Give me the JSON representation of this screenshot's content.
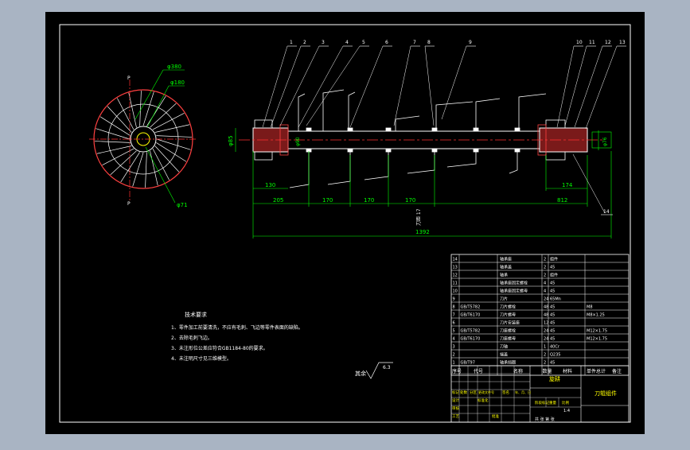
{
  "colors": {
    "background": "#a9b4c3",
    "sheet": "#000000",
    "border": "#ffffff",
    "dimension": "#00ff00",
    "centerline": "#ff3030",
    "outline": "#ff4040",
    "hatch": "#ffffff",
    "text": "#ffffff",
    "callout": "#ffffff"
  },
  "views": {
    "left_view": {
      "dia_outer": "φ380",
      "dia_mid": "φ180",
      "dia_inner": "φ71",
      "section_mark": "P"
    },
    "main_view": {
      "shaft_dia_left": "φ85",
      "shaft_dia_body": "φ90",
      "shaft_dia_right": "φ76",
      "dims": {
        "d130": "130",
        "d205": "205",
        "d170a": "170",
        "d170b": "170",
        "d170c": "170",
        "d174": "174",
        "d812": "812",
        "total": "1392"
      },
      "part_callouts": [
        "1",
        "2",
        "3",
        "4",
        "5",
        "6",
        "7",
        "8",
        "9",
        "10",
        "11",
        "12",
        "13",
        "14"
      ],
      "pitch_note": "刀距 17"
    }
  },
  "tech_requirements": {
    "title": "技术要求",
    "items": [
      "1、零件加工前要清洗，不应有毛刺、飞边等零件表面的缺陷。",
      "2、去除毛刺飞边。",
      "3、未注形位公差应符合GB1184-80的要求。",
      "4、未注明尺寸见三维模型。"
    ]
  },
  "roughness": {
    "label": "其余",
    "value": "6.3"
  },
  "bom": {
    "rows": [
      {
        "no": "14",
        "code": "",
        "name": "轴承座",
        "qty": "2",
        "material": "组件",
        "note": ""
      },
      {
        "no": "13",
        "code": "",
        "name": "轴承盖",
        "qty": "2",
        "material": "45",
        "note": ""
      },
      {
        "no": "12",
        "code": "",
        "name": "轴承",
        "qty": "2",
        "material": "组件",
        "note": ""
      },
      {
        "no": "11",
        "code": "",
        "name": "轴承座固定螺栓",
        "qty": "4",
        "material": "45",
        "note": ""
      },
      {
        "no": "10",
        "code": "",
        "name": "轴承座固定螺母",
        "qty": "4",
        "material": "45",
        "note": ""
      },
      {
        "no": "9",
        "code": "",
        "name": "刀片",
        "qty": "24",
        "material": "65Mn",
        "note": ""
      },
      {
        "no": "8",
        "code": "GB/T5782",
        "name": "刀片螺栓",
        "qty": "48",
        "material": "45",
        "note": "M8"
      },
      {
        "no": "7",
        "code": "GB/T6170",
        "name": "刀片螺母",
        "qty": "48",
        "material": "45",
        "note": "M8×1.25"
      },
      {
        "no": "6",
        "code": "",
        "name": "刀片安装座",
        "qty": "12",
        "material": "45",
        "note": ""
      },
      {
        "no": "5",
        "code": "GB/T5782",
        "name": "刀座螺栓",
        "qty": "24",
        "material": "45",
        "note": "M12×1.75"
      },
      {
        "no": "4",
        "code": "GB/T6170",
        "name": "刀座螺母",
        "qty": "24",
        "material": "45",
        "note": "M12×1.75"
      },
      {
        "no": "3",
        "code": "",
        "name": "刀轴",
        "qty": "1",
        "material": "40Cr",
        "note": ""
      },
      {
        "no": "2",
        "code": "",
        "name": "端盖",
        "qty": "2",
        "material": "Q235",
        "note": ""
      },
      {
        "no": "1",
        "code": "GB/T97",
        "name": "轴承挡圈",
        "qty": "2",
        "material": "45",
        "note": ""
      }
    ],
    "header": {
      "no": "序号",
      "code": "代号",
      "name": "名称",
      "qty": "数量",
      "material": "材料",
      "unit_weight": "单件",
      "total_weight": "总计",
      "weight": "重量",
      "note": "备注"
    }
  },
  "title_block": {
    "company": "旋耕",
    "drawing_title": "刀辊组件",
    "scale": "1:4",
    "sheet": "共 张 第 张",
    "labels": {
      "mark": "标记",
      "count": "处数",
      "zone": "分区",
      "change_doc": "更改文件号",
      "signature": "签名",
      "date": "年、月、日",
      "designer": "设计",
      "standardize": "标准化",
      "review": "审核",
      "process": "工艺",
      "approve": "批准",
      "stage_mark": "阶段标记",
      "weight": "重量",
      "scale": "比例"
    }
  }
}
